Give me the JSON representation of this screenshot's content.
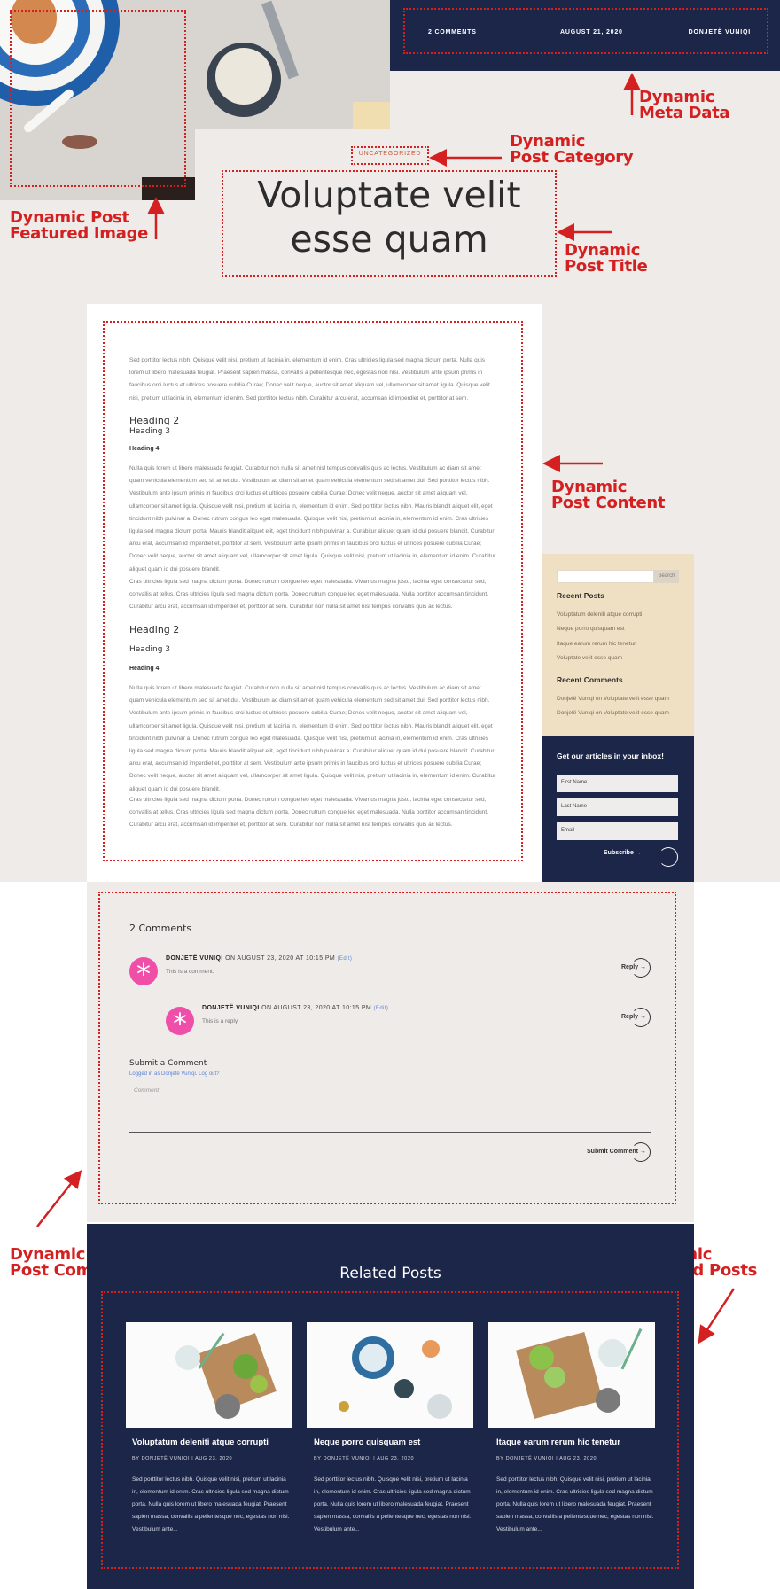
{
  "meta": {
    "comments": "2 COMMENTS",
    "date": "AUGUST 21, 2020",
    "author": "DONJETË VUNIQI"
  },
  "post": {
    "category": "UNCATEGORIZED",
    "title": "Voluptate velit esse quam"
  },
  "annotations": {
    "meta_data": [
      "Dynamic",
      "Meta Data"
    ],
    "post_category": [
      "Dynamic",
      "Post Category"
    ],
    "featured_image": [
      "Dynamic Post",
      "Featured Image"
    ],
    "post_title": [
      "Dynamic",
      "Post Title"
    ],
    "post_content": [
      "Dynamic",
      "Post Content"
    ],
    "post_comments": [
      "Dynamic",
      "Post Comments"
    ],
    "related_posts": [
      "Dynamic",
      "Related Posts"
    ]
  },
  "content": {
    "p1": "Sed porttitor lectus nibh. Quisque velit nisi, pretium ut lacinia in, elementum id enim. Cras ultricies ligula sed magna dictum porta. Nulla quis lorem ut libero malesuada feugiat. Praesent sapien massa, convallis a pellentesque nec, egestas non nisi. Vestibulum ante ipsum primis in faucibus orci luctus et ultrices posuere cubilia Curae; Donec velit neque, auctor sit amet aliquam vel, ullamcorper sit amet ligula. Quisque velit nisi, pretium ut lacinia in, elementum id enim. Sed porttitor lectus nibh. Curabitur arcu erat, accumsan id imperdiet et, porttitor at sem.",
    "h2": "Heading 2",
    "h3": "Heading 3",
    "h4": "Heading 4",
    "p2": "Nulla quis lorem ut libero malesuada feugiat. Curabitur non nulla sit amet nisl tempus convallis quis ac lectus. Vestibulum ac diam sit amet quam vehicula elementum sed sit amet dui. Vestibulum ac diam sit amet quam vehicula elementum sed sit amet dui. Sed porttitor lectus nibh. Vestibulum ante ipsum primis in faucibus orci luctus et ultrices posuere cubilia Curae; Donec velit neque, auctor sit amet aliquam vel, ullamcorper sit amet ligula. Quisque velit nisi, pretium ut lacinia in, elementum id enim. Sed porttitor lectus nibh. Mauris blandit aliquet elit, eget tincidunt nibh pulvinar a. Donec rutrum congue leo eget malesuada. Quisque velit nisi, pretium ut lacinia in, elementum id enim. Cras ultricies ligula sed magna dictum porta. Mauris blandit aliquet elit, eget tincidunt nibh pulvinar a. Curabitur aliquet quam id dui posuere blandit. Curabitur arcu erat, accumsan id imperdiet et, porttitor at sem. Vestibulum ante ipsum primis in faucibus orci luctus et ultrices posuere cubilia Curae; Donec velit neque, auctor sit amet aliquam vel, ullamcorper sit amet ligula. Quisque velit nisi, pretium ut lacinia in, elementum id enim. Curabitur aliquet quam id dui posuere blandit.",
    "p3": "Cras ultricies ligula sed magna dictum porta. Donec rutrum congue leo eget malesuada. Vivamus magna justo, lacinia eget consectetur sed, convallis at tellus. Cras ultricies ligula sed magna dictum porta. Donec rutrum congue leo eget malesuada. Nulla porttitor accumsan tincidunt. Curabitur arcu erat, accumsan id imperdiet et, porttitor at sem. Curabitur non nulla sit amet nisl tempus convallis quis ac lectus."
  },
  "sidebar": {
    "search_placeholder": "",
    "search_button": "Search",
    "recent_posts_title": "Recent Posts",
    "recent_posts": [
      "Voluptatum deleniti atque corrupti",
      "Neque porro quisquam est",
      "Itaque earum rerum hic tenetur",
      "Voluptate velit esse quam"
    ],
    "recent_comments_title": "Recent Comments",
    "recent_comments": [
      "Donjetë Vuniqi on Voluptate velit esse quam",
      "Donjetë Vuniqi on Voluptate velit esse quam"
    ]
  },
  "newsletter": {
    "title": "Get our articles in your inbox!",
    "first_name": "First Name",
    "last_name": "Last Name",
    "email": "Email",
    "subscribe": "Subscribe →"
  },
  "comments": {
    "count_title": "2 Comments",
    "list": [
      {
        "author": "DONJETË VUNIQI",
        "when": "ON AUGUST 23, 2020 AT 10:15 PM",
        "edit": "(Edit)",
        "text": "This is a comment.",
        "reply": "Reply →"
      },
      {
        "author": "DONJETË VUNIQI",
        "when": "ON AUGUST 23, 2020 AT 10:15 PM",
        "edit": "(Edit)",
        "text": "This is a reply.",
        "reply": "Reply →"
      }
    ],
    "submit_title": "Submit a Comment",
    "logged_in": "Logged in as Donjetë Vuniqi. Log out?",
    "comment_placeholder": "Comment",
    "submit_button": "Submit Comment →"
  },
  "related": {
    "title": "Related Posts",
    "cards": [
      {
        "title": "Voluptatum deleniti atque corrupti",
        "meta": "BY DONJETË VUNIQI | AUG 23, 2020",
        "excerpt": "Sed porttitor lectus nibh. Quisque velit nisi, pretium ut lacinia in, elementum id enim. Cras ultricies ligula sed magna dictum porta. Nulla quis lorem ut libero malesuada feugiat. Praesent sapien massa, convallis a pellentesque nec, egestas non nisi. Vestibulum ante..."
      },
      {
        "title": "Neque porro quisquam est",
        "meta": "BY DONJETË VUNIQI | AUG 23, 2020",
        "excerpt": "Sed porttitor lectus nibh. Quisque velit nisi, pretium ut lacinia in, elementum id enim. Cras ultricies ligula sed magna dictum porta. Nulla quis lorem ut libero malesuada feugiat. Praesent sapien massa, convallis a pellentesque nec, egestas non nisi. Vestibulum ante..."
      },
      {
        "title": "Itaque earum rerum hic tenetur",
        "meta": "BY DONJETË VUNIQI | AUG 23, 2020",
        "excerpt": "Sed porttitor lectus nibh. Quisque velit nisi, pretium ut lacinia in, elementum id enim. Cras ultricies ligula sed magna dictum porta. Nulla quis lorem ut libero malesuada feugiat. Praesent sapien massa, convallis a pellentesque nec, egestas non nisi. Vestibulum ante..."
      }
    ]
  },
  "colors": {
    "navy": "#1b2648",
    "annotation_red": "#d42020",
    "sidebar_sand": "#efdfc3",
    "page_bg": "#eeebe8",
    "avatar_pink": "#ef4fa8"
  }
}
